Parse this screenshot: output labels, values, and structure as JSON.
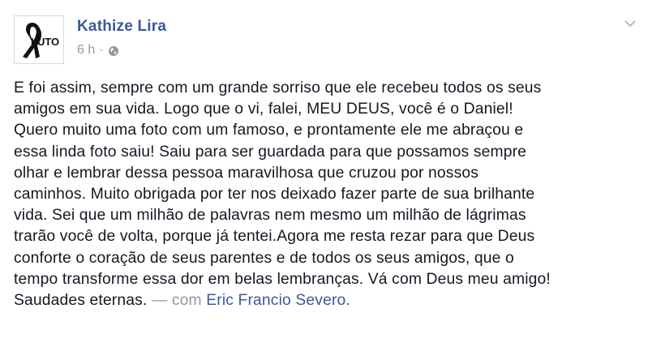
{
  "post": {
    "author_name": "Kathize Lira",
    "avatar_label": "LUTO",
    "timestamp": "6 h",
    "separator": "·",
    "privacy_icon": "globe-icon",
    "menu_icon": "chevron-down-icon",
    "text_lines": [
      "E foi assim, sempre com um grande sorriso que ele recebeu todos os seus",
      "amigos em sua vida. Logo que o vi, falei, MEU DEUS, você é o Daniel!",
      "Quero muito uma foto com um famoso, e prontamente ele me abraçou e",
      "essa linda foto saiu! Saiu para ser guardada para que possamos sempre",
      "olhar e lembrar dessa pessoa maravilhosa que cruzou por nossos",
      "caminhos. Muito obrigada por ter nos deixado fazer parte de sua brilhante",
      "vida. Sei que um milhão de palavras nem mesmo um milhão de lágrimas",
      "trarão você de volta, porque já tentei.Agora me resta rezar para que Deus",
      "conforte o coração de seus parentes e de todos os seus amigos, que o",
      "tempo transforme essa dor em belas lembranças. Vá com Deus meu amigo!"
    ],
    "last_line_text": "Saudades eternas.",
    "with_separator": " — com ",
    "tagged_person": "Eric Francio Severo."
  },
  "colors": {
    "link": "#3b5998",
    "text": "#141823",
    "meta": "#9197a3"
  }
}
